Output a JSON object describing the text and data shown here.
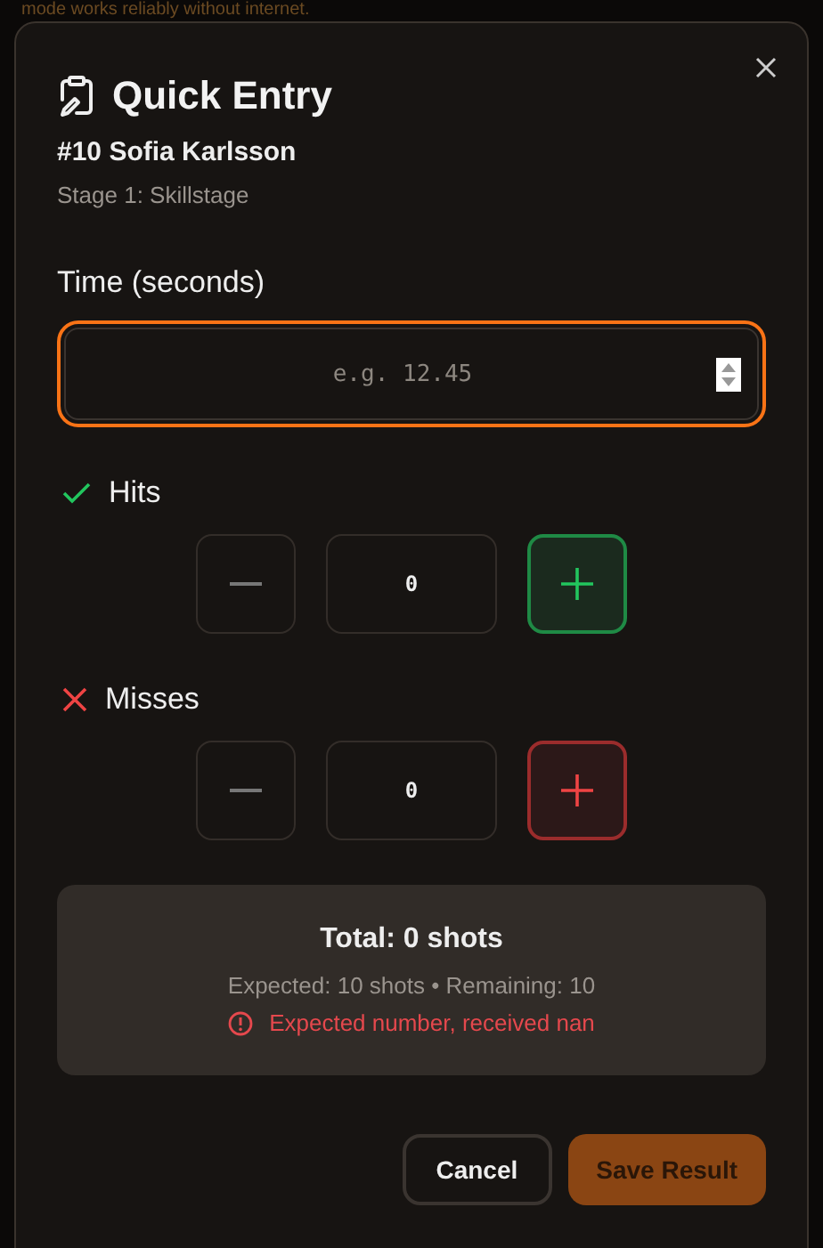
{
  "backdrop": {
    "banner_text": "mode works reliably without internet."
  },
  "dialog": {
    "title": "Quick Entry",
    "competitor": "#10 Sofia Karlsson",
    "stage": "Stage 1: Skillstage",
    "time": {
      "label": "Time (seconds)",
      "placeholder": "e.g. 12.45",
      "focused": true
    },
    "counters": [
      {
        "kind": "hit",
        "label": "Hits",
        "value": "0"
      },
      {
        "kind": "miss",
        "label": "Misses",
        "value": "0"
      }
    ],
    "summary": {
      "total": "Total: 0 shots",
      "details": "Expected: 10 shots • Remaining: 10",
      "error": "Expected number, received nan"
    },
    "buttons": [
      {
        "kind": "secondary",
        "label": "Cancel"
      },
      {
        "kind": "primary",
        "label": "Save Result"
      }
    ]
  }
}
